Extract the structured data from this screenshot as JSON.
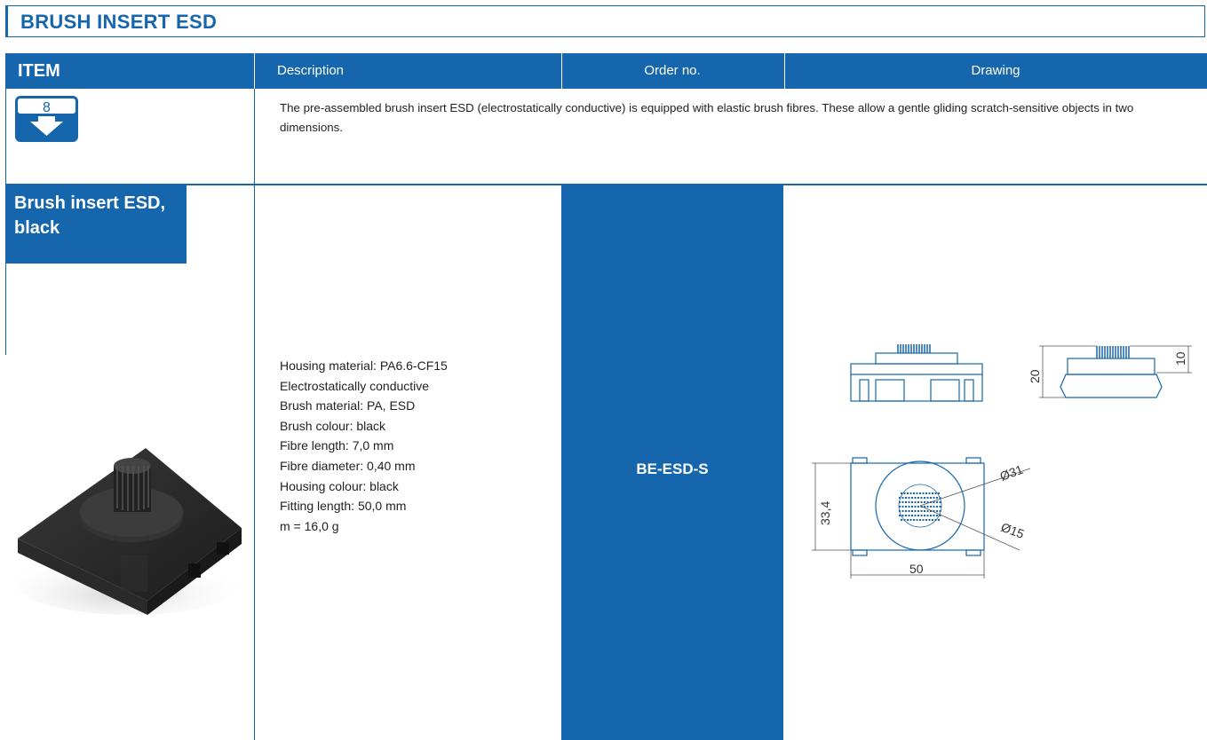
{
  "page": {
    "title": "BRUSH INSERT ESD"
  },
  "table": {
    "headers": {
      "item": "ITEM",
      "description": "Description",
      "order_no": "Order no.",
      "drawing": "Drawing"
    },
    "intro": {
      "icon_number": "8",
      "text": "The pre-assembled brush insert ESD (electrostatically conductive) is equipped with elastic brush fibres. These allow a gentle gliding scratch-sensitive objects in two dimensions."
    },
    "product": {
      "name": "Brush insert ESD, black",
      "specs": [
        "Housing material: PA6.6-CF15",
        "Electrostatically conductive",
        "Brush material: PA, ESD",
        "Brush colour: black",
        "Fibre length: 7,0 mm",
        "Fibre diameter: 0,40 mm",
        "Housing colour: black",
        "Fitting length: 50,0 mm",
        "m = 16,0 g"
      ],
      "order_no": "BE-ESD-S"
    },
    "drawing_dims": {
      "height_total": "20",
      "height_brush": "10",
      "width": "50",
      "depth": "33,4",
      "outer_dia": "Ø31",
      "inner_dia": "Ø15"
    }
  },
  "colors": {
    "brand_blue": "#1566ad"
  }
}
